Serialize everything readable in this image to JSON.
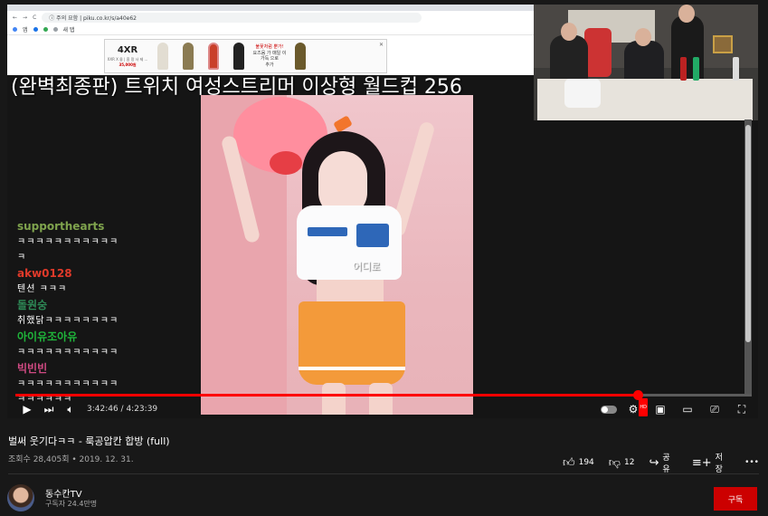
{
  "embed_browser": {
    "url": "ⓘ 주의 요함 | piku.co.kr/s/a40e62",
    "bookmarks": [
      "앱",
      "새 탭"
    ],
    "ad": {
      "brand": "4XR",
      "brand_sub": "XXR X 몰 | 흠 팡 사 제 ...",
      "price": "35,000원",
      "copy": "불꽃처럼 뿐가!",
      "copy2": "요즈음 가 매일 이 가득 으로",
      "copy3": "추가"
    }
  },
  "overlay_title": "(완벽최종판) 트위치 여성스트리머 이상형 월드컵 256",
  "caption": "어디로",
  "chat": [
    {
      "name": "supporthearts",
      "color": "#7fa34d",
      "text": "ㅋㅋㅋㅋㅋㅋㅋㅋㅋㅋㅋ\nㅋ"
    },
    {
      "name": "akw0128",
      "color": "#e03a2a",
      "text": "텐션 ㅋㅋㅋ"
    },
    {
      "name": "돌원숭",
      "color": "#2e8b57",
      "text": "취했닭ㅋㅋㅋㅋㅋㅋㅋㅋ"
    },
    {
      "name": "아이유조아유",
      "color": "#1fb53a",
      "text": "ㅋㅋㅋㅋㅋㅋㅋㅋㅋㅋㅋ"
    },
    {
      "name": "빅빈빈",
      "color": "#d14a83",
      "text": "ㅋㅋㅋㅋㅋㅋㅋㅋㅋㅋㅋ\nㅋㅋㅋㅋㅋㅋ"
    }
  ],
  "player": {
    "time": "3:42:46 / 4:23:39",
    "progress": 0.8458,
    "scroll_fraction": 0.8
  },
  "video": {
    "title": "벌써 웃기다ㅋㅋ - 룩공압칸 합방 (full)",
    "meta": "조회수 28,405회 • 2019. 12. 31.",
    "likes": "194",
    "dislikes": "12",
    "share": "공유",
    "save": "저장",
    "more": "•••"
  },
  "channel": {
    "name": "동수칸TV",
    "subs": "구독자 24.4만명",
    "subscribe": "구독"
  }
}
